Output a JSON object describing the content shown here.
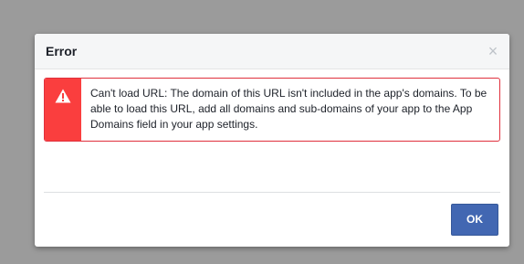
{
  "dialog": {
    "title": "Error",
    "close_label": "×",
    "error_message": "Can't load URL: The domain of this URL isn't included in the app's domains. To be able to load this URL, add all domains and sub-domains of your app to the App Domains field in your app settings.",
    "ok_label": "OK"
  },
  "icons": {
    "warning": "warning-icon",
    "close": "close-icon"
  },
  "colors": {
    "error_accent": "#fa3e3e",
    "error_border": "#e0303d",
    "primary_button": "#4267b2",
    "overlay": "#9b9b9b"
  }
}
